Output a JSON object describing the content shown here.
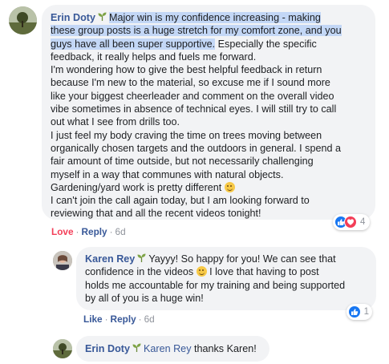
{
  "comment1": {
    "author": "Erin Doty",
    "highlight_lines": [
      "Major win is my confidence increasing - making",
      "these group posts is a huge stretch for my comfort zone, and you",
      "guys have all been super supportive."
    ],
    "line3_rest": " Especially the specific",
    "lines": [
      "feedback, it really helps and fuels me forward.",
      "I'm wondering how to give the best helpful feedback in return",
      "because I'm new to the material, so excuse me if I sound more",
      "like your biggest cheerleader and comment on the overall video",
      "vibe sometimes in absence of technical eyes. I will still try to call",
      "out what I see from drills too.",
      "I just feel my body craving the time on trees moving between",
      "organically chosen targets and the outdoors in general. I spend a",
      "fair amount of time outside, but not necessarily challenging",
      "myself in a way that communes with natural objects."
    ],
    "line_emoji": "Gardening/yard work is pretty different",
    "lines_end": [
      "I can't join the call again today, but I am looking forward to",
      "reviewing that and all the recent videos tonight!"
    ],
    "reaction_count": "4",
    "actions": {
      "reaction": "Love",
      "reply": "Reply",
      "time": "6d"
    }
  },
  "reply1": {
    "author": "Karen Rey",
    "line1": "Yayyy! So happy for you! We can see that",
    "line2a": "confidence in the videos",
    "line2b": "I love that having to post",
    "line3": "holds me accountable for my training and being supported",
    "line4": "by all of you is a huge win!",
    "reaction_count": "1",
    "actions": {
      "reaction": "Like",
      "reply": "Reply",
      "time": "6d"
    }
  },
  "reply2": {
    "author": "Erin Doty",
    "mention": "Karen Rey",
    "text": " thanks Karen!"
  },
  "colors": {
    "link": "#385898",
    "bubble": "#f2f3f5",
    "highlight": "#c3d7f6",
    "love": "#f33e58",
    "like": "#1877f2"
  },
  "icons": [
    "sprout-icon",
    "like-icon",
    "love-icon",
    "smiley-emoji-icon"
  ]
}
